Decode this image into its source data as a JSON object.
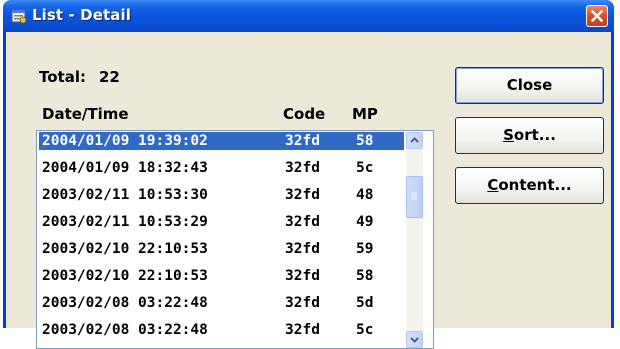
{
  "window": {
    "title": "List - Detail"
  },
  "summary": {
    "total_label": "Total:",
    "total_value": "22"
  },
  "list": {
    "headers": {
      "datetime": "Date/Time",
      "code": "Code",
      "mp": "MP"
    },
    "rows": [
      {
        "datetime": "2004/01/09 19:39:02",
        "code": "32fd",
        "mp": "58",
        "selected": true
      },
      {
        "datetime": "2004/01/09 18:32:43",
        "code": "32fd",
        "mp": "5c"
      },
      {
        "datetime": "2003/02/11 10:53:30",
        "code": "32fd",
        "mp": "48"
      },
      {
        "datetime": "2003/02/11 10:53:29",
        "code": "32fd",
        "mp": "49"
      },
      {
        "datetime": "2003/02/10 22:10:53",
        "code": "32fd",
        "mp": "59"
      },
      {
        "datetime": "2003/02/10 22:10:53",
        "code": "32fd",
        "mp": "58"
      },
      {
        "datetime": "2003/02/08 03:22:48",
        "code": "32fd",
        "mp": "5d"
      },
      {
        "datetime": "2003/02/08 03:22:48",
        "code": "32fd",
        "mp": "5c"
      }
    ]
  },
  "buttons": {
    "close": {
      "label": "Close"
    },
    "sort": {
      "accel": "S",
      "rest": "ort..."
    },
    "content": {
      "accel": "C",
      "rest": "ontent..."
    }
  },
  "colors": {
    "titlebar": "#0a55dc",
    "selection": "#316ac5",
    "dialog_bg": "#ece9d8",
    "close_button": "#d9512f"
  },
  "icons": {
    "app": "list-window-icon",
    "close": "close-icon",
    "scroll_up": "scroll-up-arrow-icon",
    "scroll_down": "scroll-down-arrow-icon",
    "scroll_grip": "scroll-grip-icon"
  }
}
